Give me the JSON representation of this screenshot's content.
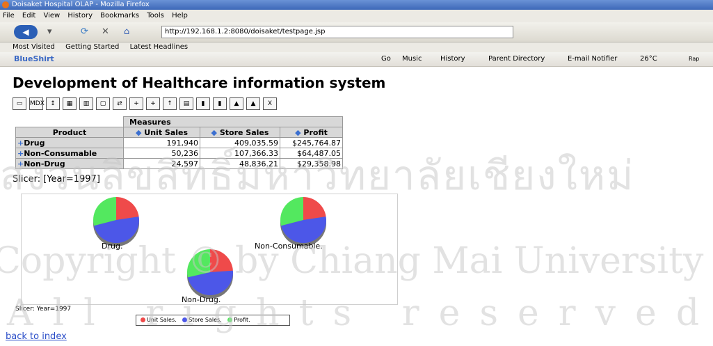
{
  "window": {
    "title": "Doisaket Hospital OLAP - Mozilla Firefox"
  },
  "menu": [
    "File",
    "Edit",
    "View",
    "History",
    "Bookmarks",
    "Tools",
    "Help"
  ],
  "nav": {
    "url": "http://192.168.1.2:8080/doisaket/testpage.jsp"
  },
  "bookmarks": [
    "Most Visited",
    "Getting Started",
    "Latest Headlines"
  ],
  "toolbar2": {
    "brand": "BlueShirt",
    "go": "Go",
    "music": "Music",
    "history": "History",
    "parent": "Parent Directory",
    "email": "E-mail Notifier",
    "temp": "26°C",
    "rap": "Rap"
  },
  "page": {
    "title": "Development of Healthcare information system",
    "slicer": "Slicer: [Year=1997]",
    "slicer_small": "Slicer: Year=1997",
    "back": "back to index"
  },
  "table": {
    "measures": "Measures",
    "headers": [
      "Product",
      "Unit Sales",
      "Store Sales",
      "Profit"
    ],
    "rows": [
      {
        "name": "Drug",
        "unit": "191,940",
        "store": "409,035.59",
        "profit": "$245,764.87"
      },
      {
        "name": "Non-Consumable",
        "unit": "50,236",
        "store": "107,366.33",
        "profit": "$64,487.05"
      },
      {
        "name": "Non-Drug",
        "unit": "24,597",
        "store": "48,836.21",
        "profit": "$29,358.98"
      }
    ]
  },
  "chart_data": {
    "type": "pie",
    "legend": [
      "Unit Sales.",
      "Store Sales.",
      "Profit."
    ],
    "charts": [
      {
        "label": "Drug.",
        "values": [
          191940,
          409035.59,
          245764.87
        ]
      },
      {
        "label": "Non-Consumable.",
        "values": [
          50236,
          107366.33,
          64487.05
        ]
      },
      {
        "label": "Non-Drug.",
        "values": [
          24597,
          48836.21,
          29358.98
        ]
      }
    ]
  },
  "watermark": {
    "line1": "สงวนลิขสิทธิ์มหาวิทยาลัยเชียงใหม่",
    "line2": "Copyright © by Chiang Mai University",
    "line3": "All rights reserved"
  },
  "colors": {
    "red": "#ef4a4a",
    "blue": "#4c57e8",
    "green": "#53e85f"
  }
}
